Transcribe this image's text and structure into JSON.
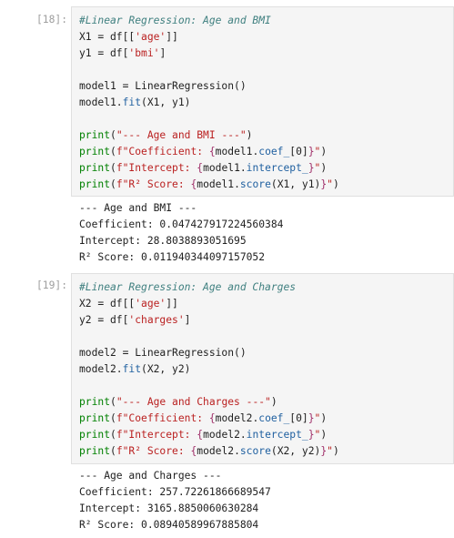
{
  "cells": [
    {
      "prompt": "[18]:",
      "code": [
        [
          {
            "t": "#Linear Regression: Age and BMI",
            "c": "cm"
          }
        ],
        [
          {
            "t": "X1 = df[[",
            "c": "plain"
          },
          {
            "t": "'age'",
            "c": "str"
          },
          {
            "t": "]]",
            "c": "plain"
          }
        ],
        [
          {
            "t": "y1 = df[",
            "c": "plain"
          },
          {
            "t": "'bmi'",
            "c": "str"
          },
          {
            "t": "]",
            "c": "plain"
          }
        ],
        [],
        [
          {
            "t": "model1 = LinearRegression()",
            "c": "plain"
          }
        ],
        [
          {
            "t": "model1.",
            "c": "plain"
          },
          {
            "t": "fit",
            "c": "attr"
          },
          {
            "t": "(X1, y1)",
            "c": "plain"
          }
        ],
        [],
        [
          {
            "t": "print",
            "c": "kw"
          },
          {
            "t": "(",
            "c": "plain"
          },
          {
            "t": "\"--- Age and BMI ---\"",
            "c": "str"
          },
          {
            "t": ")",
            "c": "plain"
          }
        ],
        [
          {
            "t": "print",
            "c": "kw"
          },
          {
            "t": "(",
            "c": "plain"
          },
          {
            "t": "f\"Coefficient: ",
            "c": "str"
          },
          {
            "t": "{",
            "c": "brace"
          },
          {
            "t": "model1.",
            "c": "plain"
          },
          {
            "t": "coef_",
            "c": "attr"
          },
          {
            "t": "[0]",
            "c": "plain"
          },
          {
            "t": "}",
            "c": "brace"
          },
          {
            "t": "\"",
            "c": "str"
          },
          {
            "t": ")",
            "c": "plain"
          }
        ],
        [
          {
            "t": "print",
            "c": "kw"
          },
          {
            "t": "(",
            "c": "plain"
          },
          {
            "t": "f\"Intercept: ",
            "c": "str"
          },
          {
            "t": "{",
            "c": "brace"
          },
          {
            "t": "model1.",
            "c": "plain"
          },
          {
            "t": "intercept_",
            "c": "attr"
          },
          {
            "t": "}",
            "c": "brace"
          },
          {
            "t": "\"",
            "c": "str"
          },
          {
            "t": ")",
            "c": "plain"
          }
        ],
        [
          {
            "t": "print",
            "c": "kw"
          },
          {
            "t": "(",
            "c": "plain"
          },
          {
            "t": "f\"R² Score: ",
            "c": "str"
          },
          {
            "t": "{",
            "c": "brace"
          },
          {
            "t": "model1.",
            "c": "plain"
          },
          {
            "t": "score",
            "c": "attr"
          },
          {
            "t": "(X1, y1)",
            "c": "plain"
          },
          {
            "t": "}",
            "c": "brace"
          },
          {
            "t": "\"",
            "c": "str"
          },
          {
            "t": ")",
            "c": "plain"
          }
        ]
      ],
      "output": [
        "--- Age and BMI ---",
        "Coefficient: 0.047427917224560384",
        "Intercept: 28.8038893051695",
        "R² Score: 0.011940344097157052"
      ]
    },
    {
      "prompt": "[19]:",
      "code": [
        [
          {
            "t": "#Linear Regression: Age and Charges",
            "c": "cm"
          }
        ],
        [
          {
            "t": "X2 = df[[",
            "c": "plain"
          },
          {
            "t": "'age'",
            "c": "str"
          },
          {
            "t": "]]",
            "c": "plain"
          }
        ],
        [
          {
            "t": "y2 = df[",
            "c": "plain"
          },
          {
            "t": "'charges'",
            "c": "str"
          },
          {
            "t": "]",
            "c": "plain"
          }
        ],
        [],
        [
          {
            "t": "model2 = LinearRegression()",
            "c": "plain"
          }
        ],
        [
          {
            "t": "model2.",
            "c": "plain"
          },
          {
            "t": "fit",
            "c": "attr"
          },
          {
            "t": "(X2, y2)",
            "c": "plain"
          }
        ],
        [],
        [
          {
            "t": "print",
            "c": "kw"
          },
          {
            "t": "(",
            "c": "plain"
          },
          {
            "t": "\"--- Age and Charges ---\"",
            "c": "str"
          },
          {
            "t": ")",
            "c": "plain"
          }
        ],
        [
          {
            "t": "print",
            "c": "kw"
          },
          {
            "t": "(",
            "c": "plain"
          },
          {
            "t": "f\"Coefficient: ",
            "c": "str"
          },
          {
            "t": "{",
            "c": "brace"
          },
          {
            "t": "model2.",
            "c": "plain"
          },
          {
            "t": "coef_",
            "c": "attr"
          },
          {
            "t": "[0]",
            "c": "plain"
          },
          {
            "t": "}",
            "c": "brace"
          },
          {
            "t": "\"",
            "c": "str"
          },
          {
            "t": ")",
            "c": "plain"
          }
        ],
        [
          {
            "t": "print",
            "c": "kw"
          },
          {
            "t": "(",
            "c": "plain"
          },
          {
            "t": "f\"Intercept: ",
            "c": "str"
          },
          {
            "t": "{",
            "c": "brace"
          },
          {
            "t": "model2.",
            "c": "plain"
          },
          {
            "t": "intercept_",
            "c": "attr"
          },
          {
            "t": "}",
            "c": "brace"
          },
          {
            "t": "\"",
            "c": "str"
          },
          {
            "t": ")",
            "c": "plain"
          }
        ],
        [
          {
            "t": "print",
            "c": "kw"
          },
          {
            "t": "(",
            "c": "plain"
          },
          {
            "t": "f\"R² Score: ",
            "c": "str"
          },
          {
            "t": "{",
            "c": "brace"
          },
          {
            "t": "model2.",
            "c": "plain"
          },
          {
            "t": "score",
            "c": "attr"
          },
          {
            "t": "(X2, y2)",
            "c": "plain"
          },
          {
            "t": "}",
            "c": "brace"
          },
          {
            "t": "\"",
            "c": "str"
          },
          {
            "t": ")",
            "c": "plain"
          }
        ]
      ],
      "output": [
        "--- Age and Charges ---",
        "Coefficient: 257.72261866689547",
        "Intercept: 3165.8850060630284",
        "R² Score: 0.08940589967885804"
      ]
    }
  ]
}
